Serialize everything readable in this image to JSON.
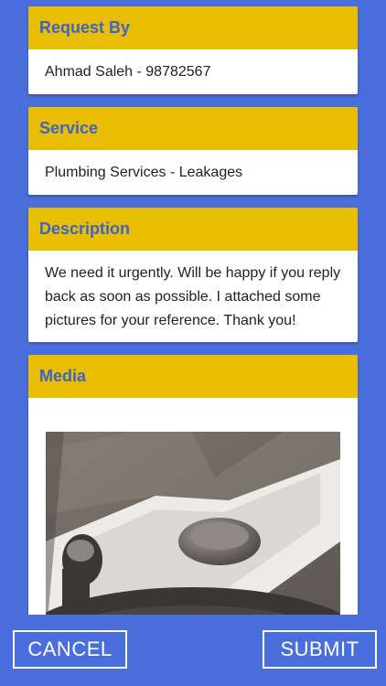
{
  "request": {
    "header": "Request By",
    "value": "Ahmad Saleh - 98782567"
  },
  "service": {
    "header": "Service",
    "value": "Plumbing Services - Leakages"
  },
  "description": {
    "header": "Description",
    "value": "We need it urgently. Will be happy if you reply back as soon as possible. I attached some pictures for your reference. Thank you!"
  },
  "media": {
    "header": "Media"
  },
  "actions": {
    "cancel": "CANCEL",
    "submit": "SUBMIT"
  },
  "colors": {
    "background": "#4a6fdc",
    "header": "#e9bd00",
    "headerText": "#3f64c8"
  }
}
